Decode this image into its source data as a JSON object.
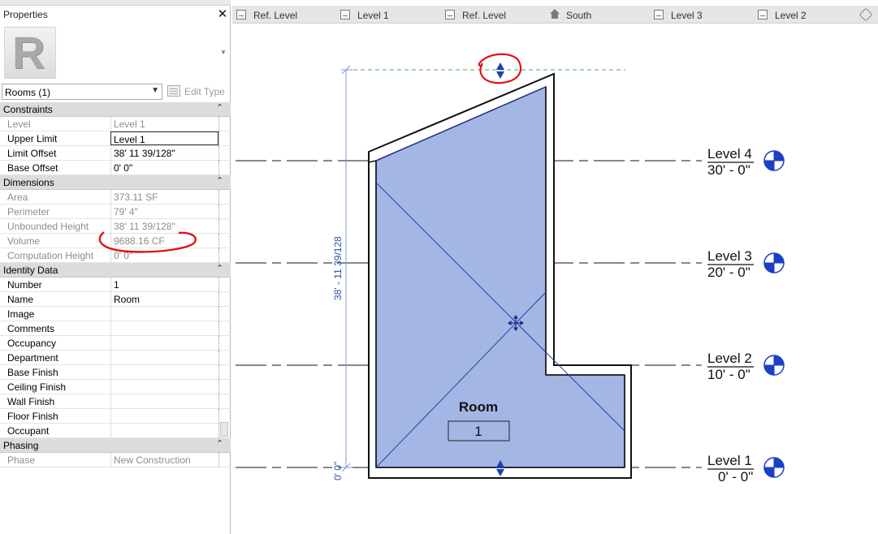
{
  "properties": {
    "title": "Properties",
    "close_glyph": "✕",
    "type_thumb_glyph": "R",
    "selector_value": "Rooms (1)",
    "edit_type_label": "Edit Type",
    "sections": {
      "constraints": {
        "label": "Constraints",
        "rows": [
          {
            "name": "Level",
            "value": "Level 1"
          },
          {
            "name": "Upper Limit",
            "value": "Level 1"
          },
          {
            "name": "Limit Offset",
            "value": "38'  11 39/128\""
          },
          {
            "name": "Base Offset",
            "value": "0'  0\""
          }
        ]
      },
      "dimensions": {
        "label": "Dimensions",
        "rows": [
          {
            "name": "Area",
            "value": "373.11 SF"
          },
          {
            "name": "Perimeter",
            "value": "79'  4\""
          },
          {
            "name": "Unbounded Height",
            "value": "38'  11 39/128\""
          },
          {
            "name": "Volume",
            "value": "9688.16 CF"
          },
          {
            "name": "Computation Height",
            "value": "0'  0\""
          }
        ]
      },
      "identity": {
        "label": "Identity Data",
        "rows": [
          {
            "name": "Number",
            "value": "1"
          },
          {
            "name": "Name",
            "value": "Room"
          },
          {
            "name": "Image",
            "value": ""
          },
          {
            "name": "Comments",
            "value": ""
          },
          {
            "name": "Occupancy",
            "value": ""
          },
          {
            "name": "Department",
            "value": ""
          },
          {
            "name": "Base Finish",
            "value": ""
          },
          {
            "name": "Ceiling Finish",
            "value": ""
          },
          {
            "name": "Wall Finish",
            "value": ""
          },
          {
            "name": "Floor Finish",
            "value": ""
          },
          {
            "name": "Occupant",
            "value": ""
          }
        ]
      },
      "phasing": {
        "label": "Phasing",
        "rows": [
          {
            "name": "Phase",
            "value": "New Construction"
          }
        ]
      }
    }
  },
  "tabs": [
    {
      "label": "Ref. Level",
      "icon": "plan-view-icon"
    },
    {
      "label": "Level 1",
      "icon": "plan-view-icon"
    },
    {
      "label": "Ref. Level",
      "icon": "plan-view-icon"
    },
    {
      "label": "South",
      "icon": "elevation-view-icon"
    },
    {
      "label": "Level 3",
      "icon": "plan-view-icon"
    },
    {
      "label": "Level 2",
      "icon": "plan-view-icon"
    }
  ],
  "canvas": {
    "levels": [
      {
        "name": "Level 4",
        "elevation": "30' - 0\""
      },
      {
        "name": "Level 3",
        "elevation": "20' - 0\""
      },
      {
        "name": "Level 2",
        "elevation": "10' - 0\""
      },
      {
        "name": "Level 1",
        "elevation": "0' - 0\""
      }
    ],
    "room_tag": {
      "name": "Room",
      "number": "1"
    },
    "dimension_height": "38' - 11 39/128",
    "dimension_base": "0' 0\"",
    "colors": {
      "room_fill": "#a4b6e4",
      "room_edge": "#2a3fa8",
      "dimension": "#2a52a8",
      "reference_line": "#4caf50",
      "annotation_markup": "#e0101a",
      "level_head": "#1c3fc6"
    }
  }
}
